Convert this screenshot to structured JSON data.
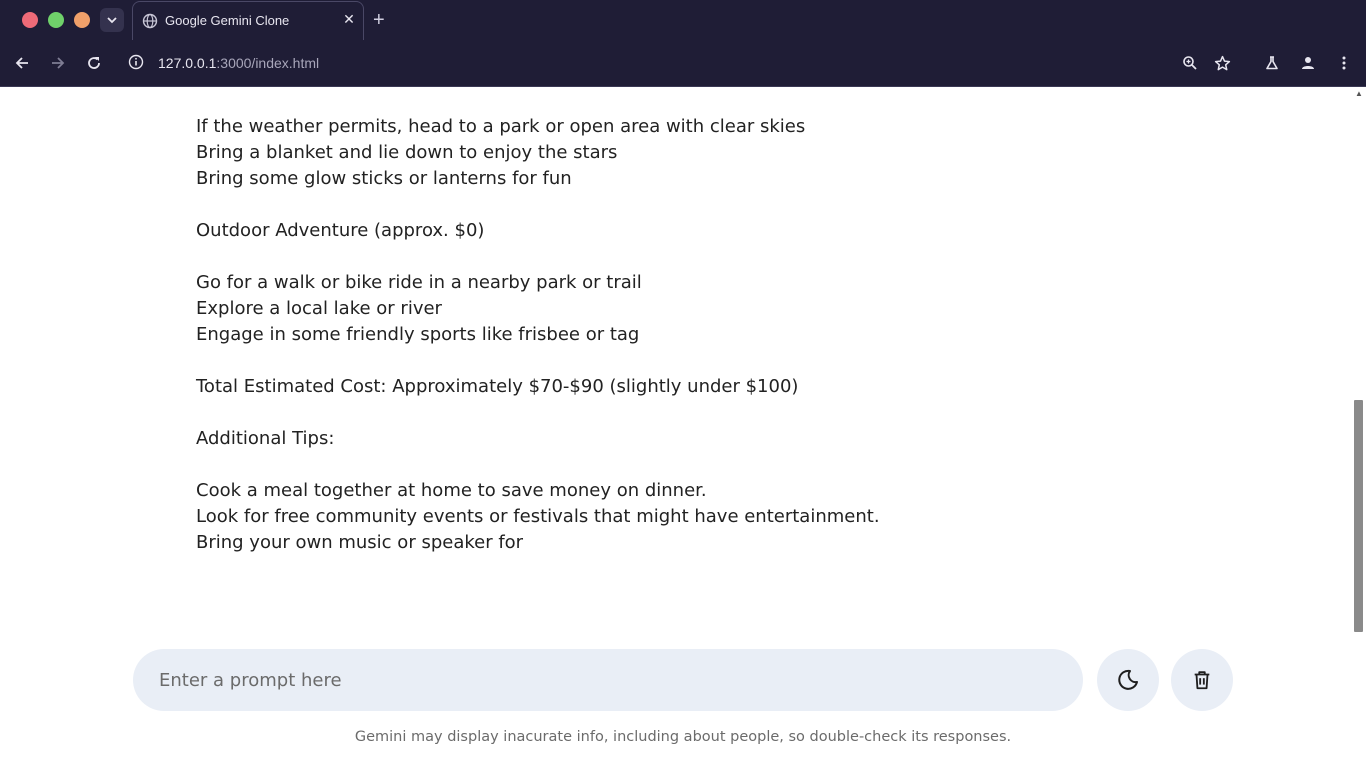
{
  "browser": {
    "tab": {
      "title": "Google Gemini Clone",
      "favicon": "globe-icon"
    },
    "address": {
      "host": "127.0.0.1",
      "rest": ":3000/index.html"
    },
    "icons": {
      "back": "arrow-left-icon",
      "forward": "arrow-right-icon",
      "reload": "reload-icon",
      "zoom": "zoom-icon",
      "bookmark": "star-icon",
      "labs": "flask-icon",
      "profile": "person-icon",
      "menu": "kebab-menu-icon"
    },
    "colors": {
      "chrome_bg": "#1f1d36",
      "traffic_red": "#ee6a78",
      "traffic_green": "#6fd16a",
      "traffic_orange": "#f0a06a"
    }
  },
  "response": {
    "lines": [
      "If the weather permits, head to a park or open area with clear skies",
      "Bring a blanket and lie down to enjoy the stars",
      "Bring some glow sticks or lanterns for fun",
      "",
      "Outdoor Adventure (approx. $0)",
      "",
      "Go for a walk or bike ride in a nearby park or trail",
      "Explore a local lake or river",
      "Engage in some friendly sports like frisbee or tag",
      "",
      "Total Estimated Cost: Approximately $70-$90 (slightly under $100)",
      "",
      "Additional Tips:",
      "",
      "Cook a meal together at home to save money on dinner.",
      "Look for free community events or festivals that might have entertainment.",
      "Bring your own music or speaker for"
    ]
  },
  "prompt": {
    "placeholder": "Enter a prompt here",
    "value": "",
    "theme_icon": "moon-icon",
    "delete_icon": "trash-icon"
  },
  "disclaimer": "Gemini may display inacurate info, including about people, so double-check its responses.",
  "colors": {
    "input_bg": "#e9eef6",
    "text": "#222222",
    "muted": "#6b6b6b"
  }
}
